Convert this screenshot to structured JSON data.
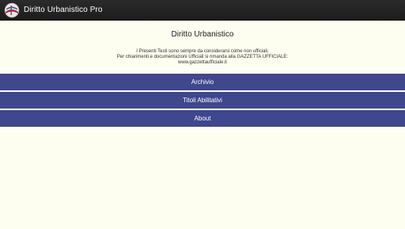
{
  "action_bar": {
    "title": "Diritto Urbanistico Pro",
    "icon": "app-logo-icon"
  },
  "main": {
    "title": "Diritto Urbanistico",
    "disclaimer": {
      "line1": "I Presenti Testi sono sempre da considerarsi come non ufficiali.",
      "line2": "Per chiarimenti e documentazioni Ufficiali si rimanda alla GAZZETTA UFFICIALE:",
      "line3": "www.gazzettaufficiale.it"
    },
    "menu": {
      "archivio": "Archivio",
      "titoli": "Titoli Abilitativi",
      "about": "About"
    }
  },
  "colors": {
    "action_bar": "#1c1c1c",
    "background": "#fdfdf0",
    "menu_button": "#3f478d"
  }
}
